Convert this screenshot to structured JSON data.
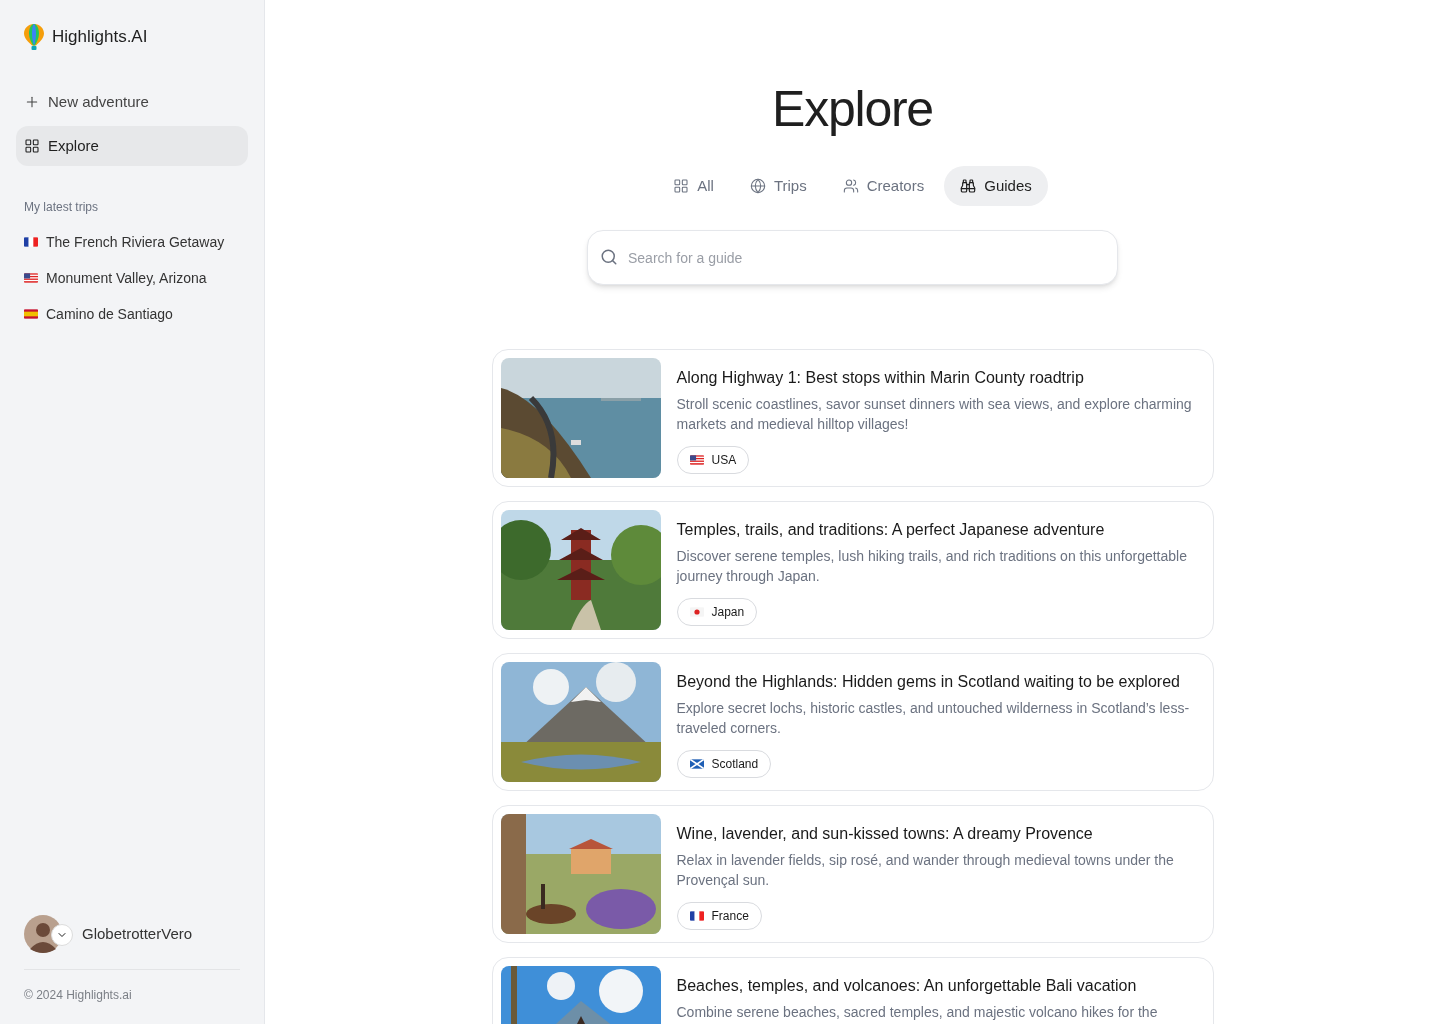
{
  "sidebar": {
    "brand": "Highlights.AI",
    "nav": [
      {
        "label": "New adventure",
        "kind": "add",
        "selected": false
      },
      {
        "label": "Explore",
        "kind": "grid",
        "selected": true
      }
    ],
    "section_title": "My latest trips",
    "trips": [
      {
        "label": "The French Riviera Getaway"
      },
      {
        "label": "Monument Valley, Arizona"
      },
      {
        "label": "Camino de Santiago"
      }
    ],
    "user": {
      "name": "GlobetrotterVero"
    },
    "footer": "© 2024 Highlights.ai"
  },
  "main": {
    "title": "Explore",
    "tabs": [
      {
        "label": "All",
        "kind": "grid",
        "selected": false
      },
      {
        "label": "Trips",
        "kind": "globe",
        "selected": false
      },
      {
        "label": "Creators",
        "kind": "people",
        "selected": false
      },
      {
        "label": "Guides",
        "kind": "binoculars",
        "selected": true
      }
    ],
    "search": {
      "placeholder": "Search for a guide"
    },
    "guides": [
      {
        "title": "Along Highway 1: Best stops within Marin County roadtrip",
        "description": "Stroll scenic coastlines, savor sunset dinners with sea views, and explore charming markets and medieval hilltop villages!",
        "tag": "USA"
      },
      {
        "title": "Temples, trails, and traditions: A perfect Japanese adventure",
        "description": "Discover serene temples, lush hiking trails, and rich traditions on this unforgettable journey through Japan.",
        "tag": "Japan"
      },
      {
        "title": "Beyond the Highlands: Hidden gems in Scotland waiting to be explored",
        "description": "Explore secret lochs, historic castles, and untouched wilderness in Scotland’s less-traveled corners.",
        "tag": "Scotland"
      },
      {
        "title": "Wine, lavender, and sun-kissed towns: A dreamy Provence",
        "description": "Relax in lavender fields, sip rosé, and wander through medieval towns under the Provençal sun.",
        "tag": "France"
      },
      {
        "title": "Beaches, temples, and volcanoes: An unforgettable Bali vacation",
        "description": "Combine serene beaches, sacred temples, and majestic volcano hikes for the"
      }
    ]
  }
}
